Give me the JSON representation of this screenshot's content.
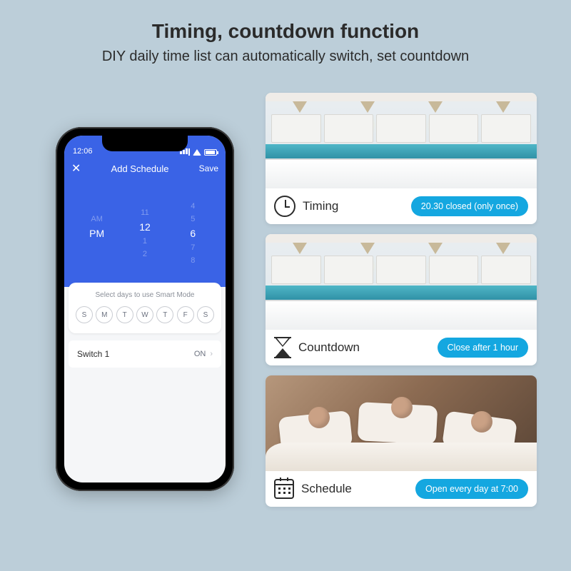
{
  "headline": "Timing, countdown function",
  "subhead": "DIY daily time list can automatically switch, set countdown",
  "phone": {
    "status_time": "12:06",
    "nav_close_glyph": "✕",
    "nav_title": "Add Schedule",
    "nav_save": "Save",
    "picker": {
      "ampm": [
        "AM",
        "PM"
      ],
      "ampm_sel": 1,
      "hours": [
        "11",
        "12",
        "1",
        "2"
      ],
      "hours_sel": 1,
      "mins": [
        "4",
        "5",
        "6",
        "7",
        "8"
      ],
      "mins_sel": 2
    },
    "sheet_title": "Select days to use Smart Mode",
    "days": [
      "S",
      "M",
      "T",
      "W",
      "T",
      "F",
      "S"
    ],
    "row_label": "Switch 1",
    "row_value": "ON",
    "row_chev": "›"
  },
  "cards": [
    {
      "label": "Timing",
      "pill": "20.30 closed (only once)",
      "icon": "clock",
      "scene": "kitchen"
    },
    {
      "label": "Countdown",
      "pill": "Close after 1 hour",
      "icon": "hourglass",
      "scene": "kitchen"
    },
    {
      "label": "Schedule",
      "pill": "Open every day at 7:00",
      "icon": "calendar",
      "scene": "bedroom"
    }
  ]
}
